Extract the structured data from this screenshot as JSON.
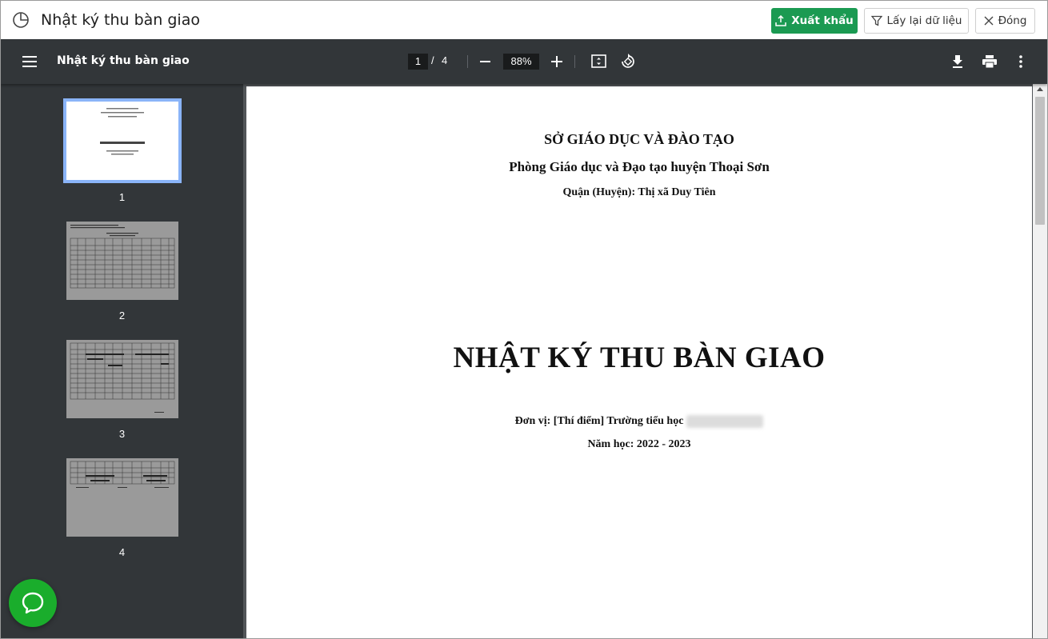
{
  "app": {
    "title": "Nhật ký thu bàn giao",
    "buttons": {
      "export_label": "Xuất khẩu",
      "reload_label": "Lấy lại dữ liệu",
      "close_label": "Đóng"
    },
    "colors": {
      "accent": "#1b9a52",
      "viewer_bg": "#323639",
      "chat": "#1aad2c"
    }
  },
  "viewer": {
    "doc_title": "Nhật ký thu bàn giao",
    "current_page": "1",
    "page_sep": "/",
    "total_pages": "4",
    "zoom": "88%"
  },
  "thumbnails": [
    {
      "label": "1",
      "active": true
    },
    {
      "label": "2",
      "active": false
    },
    {
      "label": "3",
      "active": false
    },
    {
      "label": "4",
      "active": false
    }
  ],
  "document": {
    "header1": "SỞ GIÁO DỤC VÀ ĐÀO TẠO",
    "header2": "Phòng Giáo dục và Đạo tạo huyện Thoại Sơn",
    "header3": "Quận (Huyện): Thị xã Duy Tiên",
    "main_title": "NHẬT KÝ THU BÀN GIAO",
    "unit": "Đơn vị: [Thí điểm] Trường tiểu học",
    "school_year": "Năm học: 2022 - 2023"
  }
}
